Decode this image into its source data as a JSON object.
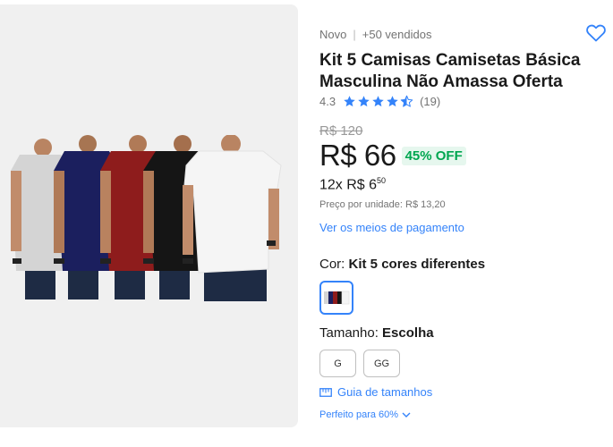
{
  "product": {
    "condition": "Novo",
    "sold": "+50 vendidos",
    "title": "Kit 5 Camisas Camisetas Básica Masculina Não Amassa Oferta",
    "rating": "4.3",
    "rating_value": 4.3,
    "review_count": "(19)",
    "old_price": "R$ 120",
    "price": "R$ 66",
    "discount": "45% OFF",
    "installments_prefix": "12x R$ 6",
    "installments_cents": "50",
    "unit_price": "Preço por unidade: R$ 13,20",
    "payment_link": "Ver os meios de pagamento"
  },
  "variations": {
    "color_label": "Cor:",
    "color_value": "Kit 5 cores diferentes",
    "size_label": "Tamanho:",
    "size_value": "Escolha",
    "sizes": [
      "G",
      "GG"
    ],
    "size_guide": "Guia de tamanhos",
    "fit": "Perfeito para 60%"
  },
  "colors": {
    "accent": "#3483fa",
    "discount_green": "#00a650",
    "star": "#3483fa",
    "shirts": [
      "#d4d4d4",
      "#1b1f5e",
      "#8e1c1c",
      "#151515",
      "#f5f5f5"
    ]
  },
  "icons": {
    "favorite": "heart-icon",
    "star": "star-icon",
    "size_guide": "ruler-icon",
    "fit": "chevron-down-icon"
  }
}
